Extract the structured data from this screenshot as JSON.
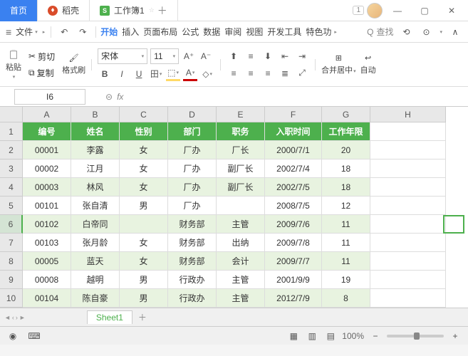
{
  "titlebar": {
    "home": "首页",
    "shell": "稻壳",
    "workbook": "工作簿1",
    "badge": "1"
  },
  "menubar": {
    "file": "文件",
    "tabs": [
      "开始",
      "插入",
      "页面布局",
      "公式",
      "数据",
      "审阅",
      "视图",
      "开发工具",
      "特色功"
    ],
    "search": "查找"
  },
  "toolbar": {
    "paste": "粘贴",
    "cut": "剪切",
    "copy": "复制",
    "format": "格式刷",
    "font": "宋体",
    "size": "11",
    "merge": "合并居中",
    "wrap": "自动"
  },
  "formula_bar": {
    "name_box": "I6",
    "fx": "fx"
  },
  "columns": [
    "A",
    "B",
    "C",
    "D",
    "E",
    "F",
    "G",
    "H"
  ],
  "row_numbers": [
    "1",
    "2",
    "3",
    "4",
    "5",
    "6",
    "7",
    "8",
    "9",
    "10"
  ],
  "chart_data": {
    "type": "table",
    "headers": [
      "编号",
      "姓名",
      "性别",
      "部门",
      "职务",
      "入职时间",
      "工作年限"
    ],
    "rows": [
      [
        "00001",
        "李露",
        "女",
        "厂办",
        "厂长",
        "2000/7/1",
        "20"
      ],
      [
        "00002",
        "江月",
        "女",
        "厂办",
        "副厂长",
        "2002/7/4",
        "18"
      ],
      [
        "00003",
        "林风",
        "女",
        "厂办",
        "副厂长",
        "2002/7/5",
        "18"
      ],
      [
        "00101",
        "张自清",
        "男",
        "厂办",
        "",
        "2008/7/5",
        "12"
      ],
      [
        "00102",
        "白帝同",
        "",
        "财务部",
        "主管",
        "2009/7/6",
        "11"
      ],
      [
        "00103",
        "张月龄",
        "女",
        "财务部",
        "出纳",
        "2009/7/8",
        "11"
      ],
      [
        "00005",
        "蓝天",
        "女",
        "财务部",
        "会计",
        "2009/7/7",
        "11"
      ],
      [
        "00008",
        "越明",
        "男",
        "行政办",
        "主管",
        "2001/9/9",
        "19"
      ],
      [
        "00104",
        "陈自豪",
        "男",
        "行政办",
        "主管",
        "2012/7/9",
        "8"
      ]
    ]
  },
  "sheet": {
    "name": "Sheet1"
  },
  "statusbar": {
    "zoom": "100%"
  }
}
